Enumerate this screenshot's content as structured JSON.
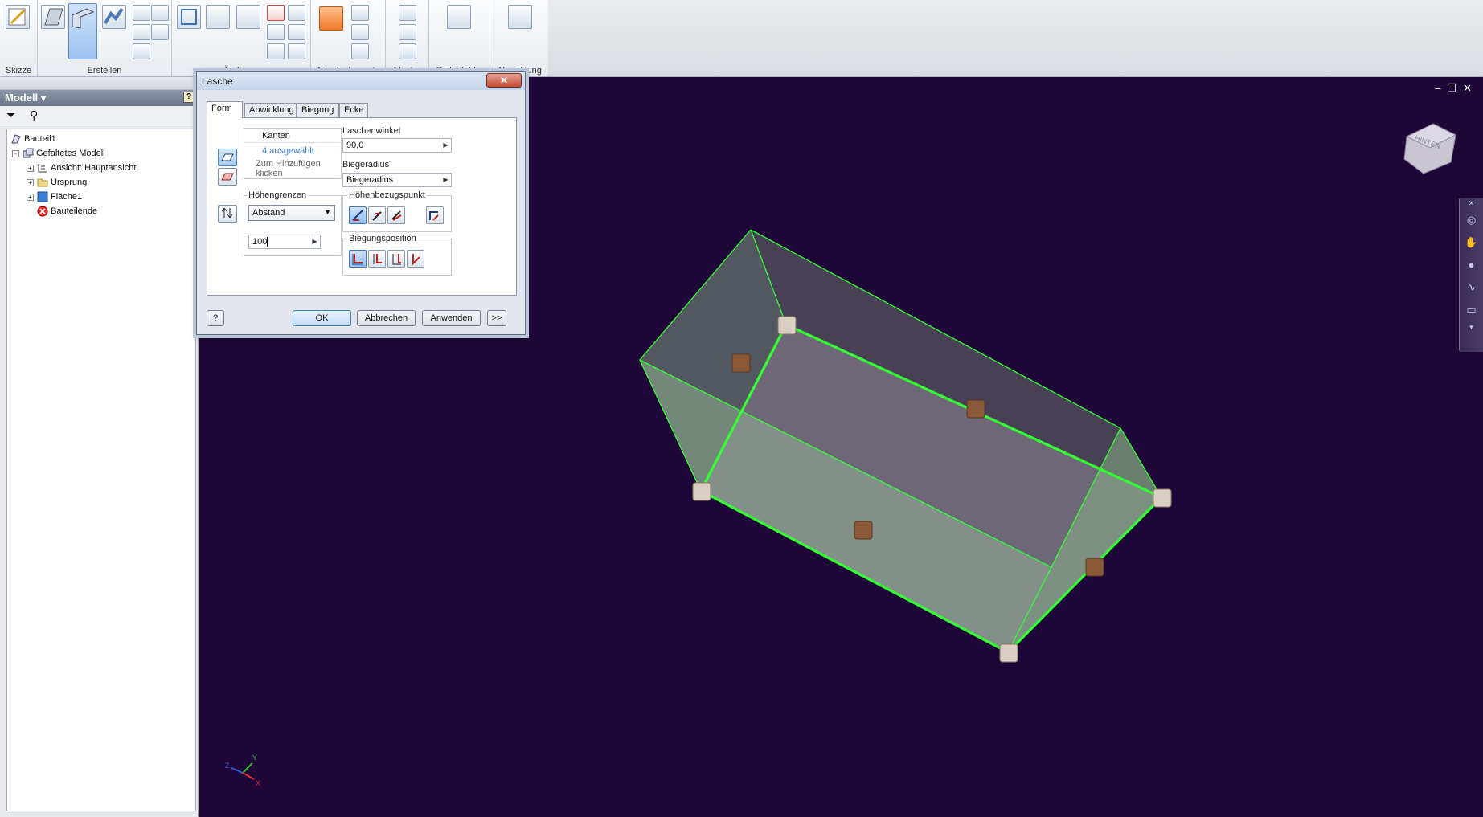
{
  "ribbon": {
    "groups": [
      {
        "label": "Skizze"
      },
      {
        "label": "Erstellen"
      },
      {
        "label": "Ändern",
        "dropdown": true
      },
      {
        "label": "Arbeitselemente"
      },
      {
        "label": "Muster"
      },
      {
        "label": "Dialogfeld",
        "dropdown": true
      },
      {
        "label": "Abwicklung"
      }
    ]
  },
  "browser": {
    "title": "Modell",
    "tree": [
      {
        "label": "Bauteil1",
        "level": 0,
        "icon": "part-icon"
      },
      {
        "label": "Gefaltetes Modell",
        "level": 1,
        "icon": "folded-model-icon",
        "toggle": "-"
      },
      {
        "label": "Ansicht: Hauptansicht",
        "level": 2,
        "icon": "view-icon",
        "toggle": "+"
      },
      {
        "label": "Ursprung",
        "level": 2,
        "icon": "folder-icon",
        "toggle": "+"
      },
      {
        "label": "Fläche1",
        "level": 2,
        "icon": "face-icon",
        "toggle": "+"
      },
      {
        "label": "Bauteilende",
        "level": 2,
        "icon": "end-of-part-icon"
      }
    ]
  },
  "dialog": {
    "title": "Lasche",
    "close_label": "✕",
    "tabs": [
      "Form",
      "Abwicklung",
      "Biegung",
      "Ecke"
    ],
    "active_tab": "Form",
    "kanten": {
      "header": "Kanten",
      "selected": "4 ausgewählt",
      "add_hint": "Zum Hinzufügen klicken"
    },
    "laschenwinkel": {
      "label": "Laschenwinkel",
      "value": "90,0"
    },
    "biegeradius": {
      "label": "Biegeradius",
      "value": "Biegeradius"
    },
    "hoehengrenzen": {
      "label": "Höhengrenzen",
      "select_value": "Abstand",
      "value": "100"
    },
    "hoehenbezugspunkt": {
      "label": "Höhenbezugspunkt"
    },
    "biegungsposition": {
      "label": "Biegungsposition"
    },
    "buttons": {
      "ok": "OK",
      "cancel": "Abbrechen",
      "apply": "Anwenden",
      "more": ">>",
      "help": "?"
    }
  },
  "viewport": {
    "background": "#1f0638",
    "edge_color": "#33ff33",
    "viewcube_label": "HINTEN"
  }
}
